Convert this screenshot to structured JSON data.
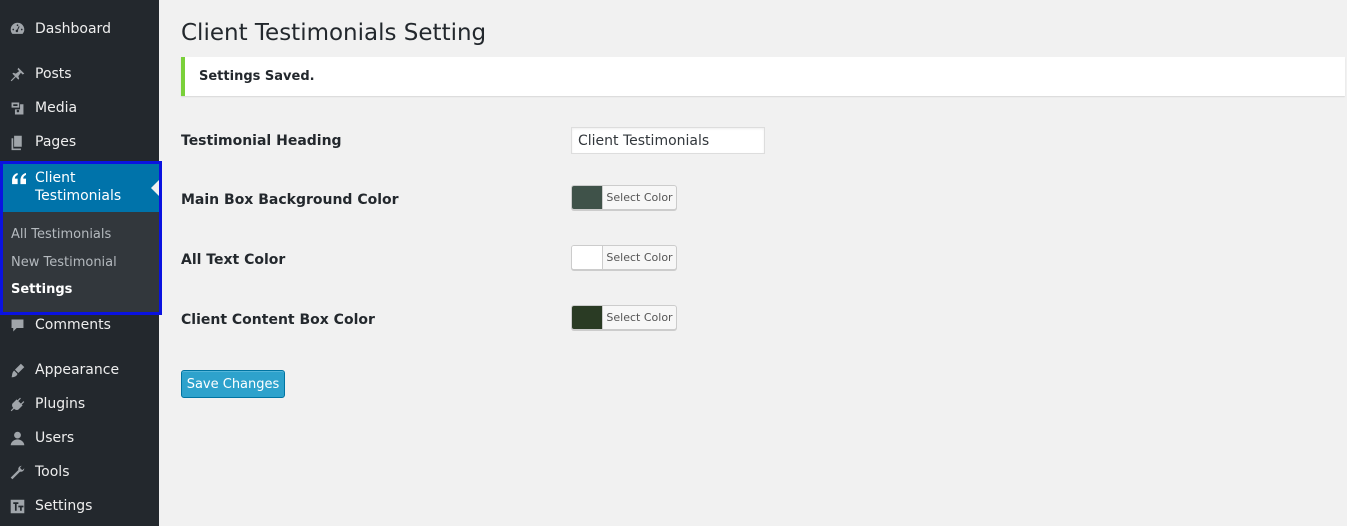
{
  "sidebar": {
    "items": [
      {
        "label": "Dashboard",
        "icon": "dashboard-icon"
      },
      {
        "label": "Posts",
        "icon": "pin-icon"
      },
      {
        "label": "Media",
        "icon": "media-icon"
      },
      {
        "label": "Pages",
        "icon": "pages-icon"
      },
      {
        "label": "Comments",
        "icon": "comment-icon"
      },
      {
        "label": "Appearance",
        "icon": "brush-icon"
      },
      {
        "label": "Plugins",
        "icon": "plugin-icon"
      },
      {
        "label": "Users",
        "icon": "user-icon"
      },
      {
        "label": "Tools",
        "icon": "wrench-icon"
      },
      {
        "label": "Settings",
        "icon": "settings-icon"
      }
    ],
    "active": {
      "label_line1": "Client",
      "label_line2": "Testimonials",
      "icon": "quote-icon",
      "submenu": [
        {
          "label": "All Testimonials"
        },
        {
          "label": "New Testimonial"
        },
        {
          "label": "Settings"
        }
      ]
    }
  },
  "main": {
    "title": "Client Testimonials Setting",
    "notice": "Settings Saved.",
    "fields": {
      "heading_label": "Testimonial Heading",
      "heading_value": "Client Testimonials",
      "main_box_label": "Main Box Background Color",
      "text_color_label": "All Text Color",
      "content_box_label": "Client Content Box Color",
      "select_color": "Select Color"
    },
    "colors": {
      "main_box": "#3f5249",
      "text": "#ffffff",
      "content_box": "#2a3b24"
    },
    "save_label": "Save Changes"
  }
}
